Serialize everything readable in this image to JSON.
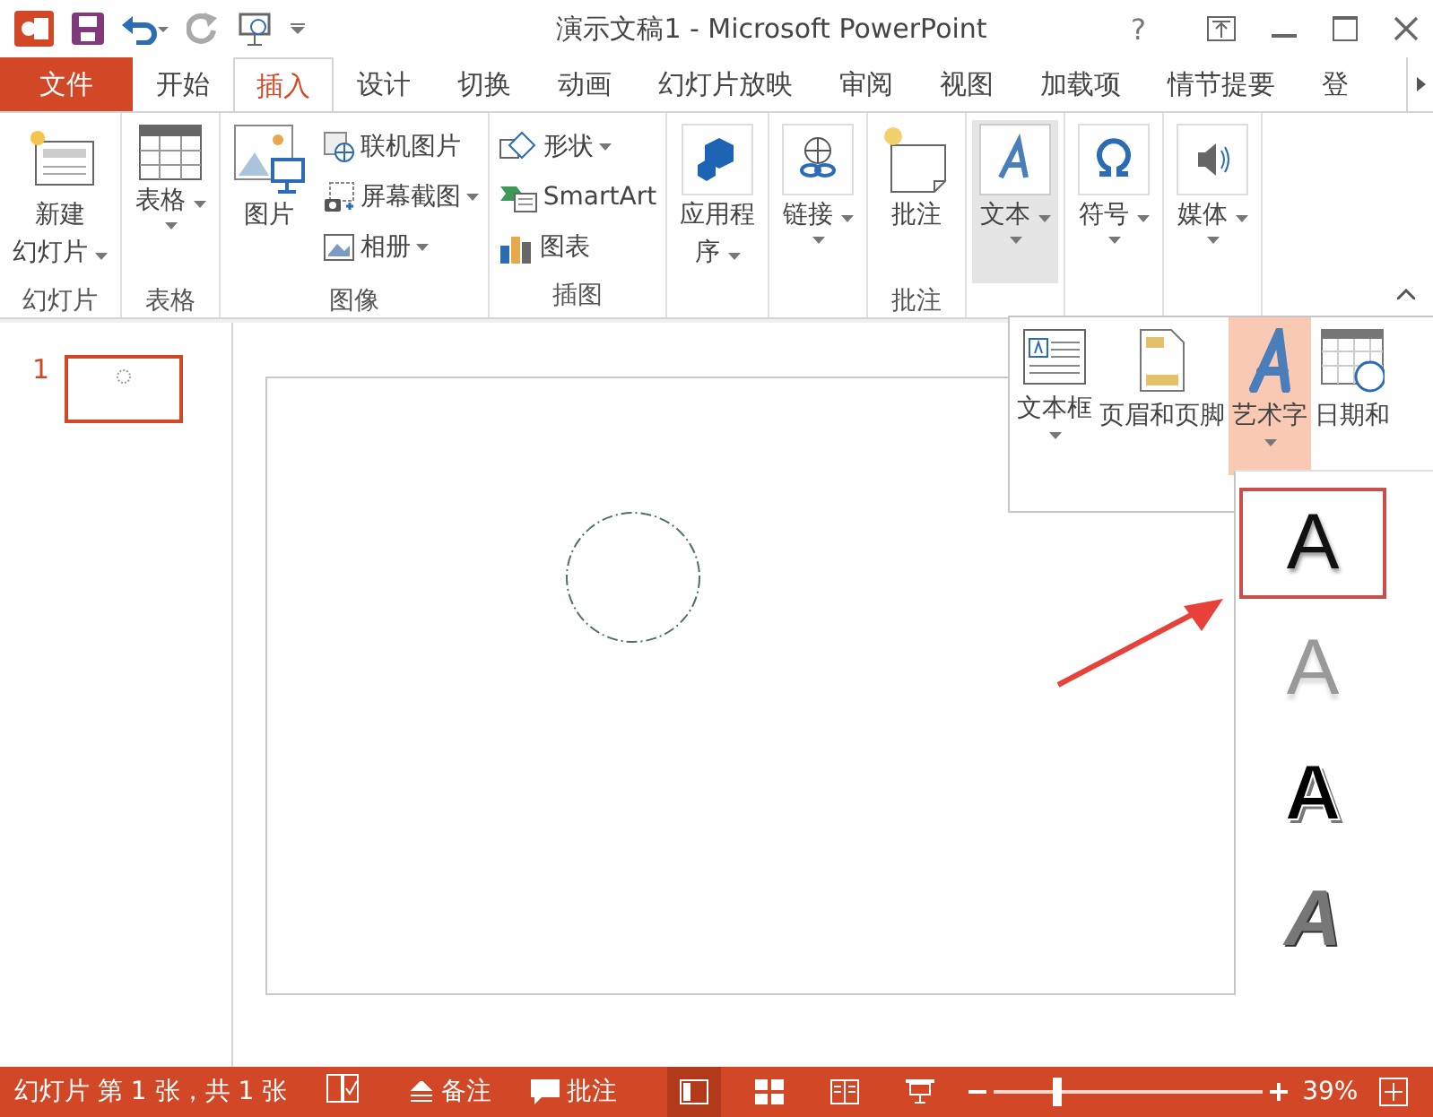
{
  "titlebar": {
    "title": "演示文稿1 - Microsoft PowerPoint",
    "help": "?"
  },
  "tabs": [
    {
      "label": "文件",
      "kind": "file",
      "selected": false
    },
    {
      "label": "开始",
      "kind": "tab",
      "selected": false
    },
    {
      "label": "插入",
      "kind": "tab",
      "selected": true
    },
    {
      "label": "设计",
      "kind": "tab",
      "selected": false
    },
    {
      "label": "切换",
      "kind": "tab",
      "selected": false
    },
    {
      "label": "动画",
      "kind": "tab",
      "selected": false
    },
    {
      "label": "幻灯片放映",
      "kind": "tab",
      "selected": false
    },
    {
      "label": "审阅",
      "kind": "tab",
      "selected": false
    },
    {
      "label": "视图",
      "kind": "tab",
      "selected": false
    },
    {
      "label": "加载项",
      "kind": "tab",
      "selected": false
    },
    {
      "label": "情节提要",
      "kind": "tab",
      "selected": false
    },
    {
      "label": "登",
      "kind": "tab",
      "selected": false
    }
  ],
  "ribbon": {
    "groups": [
      {
        "label": "幻灯片",
        "items": [
          {
            "kind": "large",
            "lines": [
              "新建",
              "幻灯片"
            ],
            "dropdown": true,
            "expanded": false
          }
        ]
      },
      {
        "label": "表格",
        "items": [
          {
            "kind": "large",
            "lines": [
              "表格"
            ],
            "dropdown": true,
            "expanded": false
          }
        ]
      },
      {
        "label": "图像",
        "items": [
          {
            "kind": "large",
            "lines": [
              "图片"
            ],
            "dropdown": false,
            "expanded": false
          },
          {
            "kind": "small",
            "label": "联机图片",
            "dropdown": false
          },
          {
            "kind": "small",
            "label": "屏幕截图",
            "dropdown": true
          },
          {
            "kind": "small",
            "label": "相册",
            "dropdown": true
          }
        ]
      },
      {
        "label": "插图",
        "items": [
          {
            "kind": "small",
            "label": "形状",
            "dropdown": true
          },
          {
            "kind": "small",
            "label": "SmartArt",
            "dropdown": false
          },
          {
            "kind": "small",
            "label": "图表",
            "dropdown": false
          }
        ]
      },
      {
        "items": [
          {
            "kind": "large",
            "lines": [
              "应用程",
              "序"
            ],
            "dropdown": true,
            "expanded": false
          }
        ]
      },
      {
        "items": [
          {
            "kind": "large",
            "lines": [
              "链接"
            ],
            "dropdown": true,
            "expanded": false
          }
        ]
      },
      {
        "label": "批注",
        "items": [
          {
            "kind": "large",
            "lines": [
              "批注"
            ],
            "dropdown": false,
            "expanded": false
          }
        ]
      },
      {
        "items": [
          {
            "kind": "large",
            "lines": [
              "文本"
            ],
            "dropdown": true,
            "expanded": true
          }
        ]
      },
      {
        "items": [
          {
            "kind": "large",
            "lines": [
              "符号"
            ],
            "dropdown": true,
            "expanded": false
          }
        ]
      },
      {
        "items": [
          {
            "kind": "large",
            "lines": [
              "媒体"
            ],
            "dropdown": true,
            "expanded": false
          }
        ]
      }
    ]
  },
  "text_menu": {
    "items": [
      {
        "label": "文本框",
        "dropdown": true,
        "selected": false
      },
      {
        "label": "页眉和页脚",
        "dropdown": false,
        "selected": false
      },
      {
        "label": "艺术字",
        "dropdown": true,
        "selected": true
      },
      {
        "label": "日期和",
        "dropdown": false,
        "selected": false
      }
    ]
  },
  "wordart_gallery": {
    "styles": [
      {
        "text": "A",
        "kind": "shadow",
        "selected": true
      },
      {
        "text": "A",
        "kind": "grey-gradient",
        "selected": false
      },
      {
        "text": "A",
        "kind": "bold-outline",
        "selected": false
      },
      {
        "text": "A",
        "kind": "hatched",
        "selected": false
      }
    ]
  },
  "slides_pane": {
    "slides": [
      {
        "number": "1",
        "selected": true
      }
    ]
  },
  "status_bar": {
    "slide_info": "幻灯片 第 1 张，共 1 张",
    "notes": "备注",
    "comments": "批注",
    "views": [
      {
        "kind": "normal",
        "selected": true
      },
      {
        "kind": "sorter",
        "selected": false
      },
      {
        "kind": "reading",
        "selected": false
      },
      {
        "kind": "slideshow",
        "selected": false
      }
    ],
    "zoom": {
      "level": 0.23,
      "reading": "39%"
    }
  }
}
